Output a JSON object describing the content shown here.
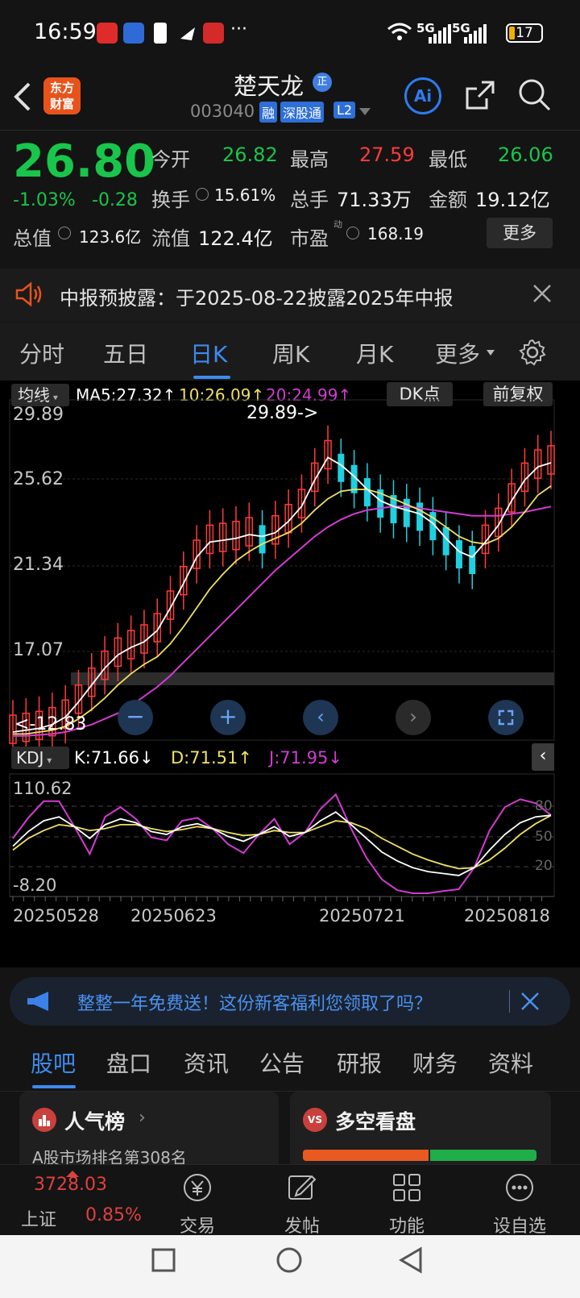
{
  "status_bar": {
    "time": "16:59",
    "network1": "5G",
    "network2": "5G",
    "battery": "17",
    "more": "···"
  },
  "header": {
    "logo_line1": "东方",
    "logo_line2": "财富",
    "stock_name": "楚天龙",
    "badge_zheng": "正",
    "stock_code": "003040",
    "tag_rong": "融",
    "tag_sgt": "深股通",
    "tag_l2": "L2",
    "ai_label": "Ai"
  },
  "quote": {
    "price": "26.80",
    "change_pct": "-1.03%",
    "change_abs": "-0.28",
    "open_label": "今开",
    "open": "26.82",
    "high_label": "最高",
    "high": "27.59",
    "low_label": "最低",
    "low": "26.06",
    "turnover_label": "换手",
    "turnover": "15.61%",
    "volume_label": "总手",
    "volume": "71.33万",
    "amount_label": "金额",
    "amount": "19.12亿",
    "mktcap_label": "总值",
    "mktcap": "123.6亿",
    "float_label": "流值",
    "float": "122.4亿",
    "pe_label": "市盈",
    "pe_sup": "动",
    "pe": "168.19",
    "more_button": "更多"
  },
  "notice": {
    "text": "中报预披露：于2025-08-22披露2025年中报"
  },
  "chart_tabs": {
    "items": [
      "分时",
      "五日",
      "日K",
      "周K",
      "月K",
      "更多"
    ],
    "active": "日K"
  },
  "kline": {
    "ma_selector": "均线",
    "ma5_label": "MA5:27.32↑",
    "ma10_label": "10:26.09↑",
    "ma20_label": "20:24.99↑",
    "dk_button": "DK点",
    "adjust_button": "前复权",
    "y_ticks": [
      "29.89",
      "25.62",
      "21.34",
      "17.07"
    ],
    "high_annotation": "29.89->",
    "low_annotation": "<-12.83",
    "colors": {
      "up": "#ff3b3b",
      "down": "#1fd0e0",
      "ma5": "#ffffff",
      "ma10": "#f0e060",
      "ma20": "#d33bd3"
    }
  },
  "kdj": {
    "selector": "KDJ",
    "k_label": "K:71.66↓",
    "d_label": "D:71.51↑",
    "j_label": "J:71.95↓",
    "y_top": "110.62",
    "y_bottom": "-8.20",
    "level_80": "80",
    "level_50": "50",
    "level_20": "20"
  },
  "x_axis": {
    "dates": [
      "20250528",
      "20250623",
      "20250721",
      "20250818"
    ]
  },
  "chart_data": {
    "type": "candlestick",
    "title": "",
    "y_range": [
      12.83,
      29.89
    ],
    "last_ma": {
      "ma5": 27.32,
      "ma10": 26.09,
      "ma20": 24.99
    },
    "x_ticks": [
      "20250528",
      "20250623",
      "20250721",
      "20250818"
    ],
    "series": [
      {
        "name": "MA5",
        "values": [
          13.0,
          13.1,
          13.2,
          13.4,
          13.8,
          14.6,
          15.5,
          16.4,
          17.1,
          17.5,
          17.8,
          18.4,
          19.6,
          20.9,
          22.3,
          23.1,
          23.2,
          23.3,
          23.5,
          23.4,
          23.6,
          24.2,
          25.0,
          26.4,
          27.6,
          27.2,
          26.6,
          25.9,
          25.3,
          25.0,
          24.8,
          24.6,
          24.1,
          23.3,
          22.6,
          22.3,
          23.1,
          24.0,
          25.3,
          26.4,
          27.1,
          27.32
        ]
      },
      {
        "name": "10",
        "values": [
          12.9,
          12.9,
          13.0,
          13.1,
          13.3,
          13.7,
          14.2,
          14.8,
          15.5,
          16.1,
          16.6,
          17.0,
          17.7,
          18.6,
          19.6,
          20.6,
          21.4,
          22.1,
          22.6,
          23.0,
          23.3,
          23.6,
          24.1,
          24.8,
          25.4,
          25.8,
          25.9,
          25.9,
          25.7,
          25.4,
          25.1,
          24.8,
          24.4,
          23.9,
          23.4,
          23.1,
          23.0,
          23.3,
          23.9,
          24.7,
          25.6,
          26.09
        ]
      },
      {
        "name": "20",
        "values": [
          12.8,
          12.8,
          12.85,
          12.9,
          13.0,
          13.2,
          13.4,
          13.7,
          14.0,
          14.4,
          14.9,
          15.4,
          16.0,
          16.7,
          17.4,
          18.1,
          18.8,
          19.5,
          20.2,
          20.9,
          21.6,
          22.2,
          22.8,
          23.4,
          23.9,
          24.3,
          24.6,
          24.8,
          24.9,
          25.0,
          25.0,
          24.9,
          24.8,
          24.7,
          24.6,
          24.5,
          24.5,
          24.5,
          24.6,
          24.7,
          24.85,
          24.99
        ]
      }
    ]
  },
  "banner": {
    "text": "整整一年免费送！这份新客福利您领取了吗？"
  },
  "bottom_tabs": {
    "items": [
      "股吧",
      "盘口",
      "资讯",
      "公告",
      "研报",
      "财务",
      "资料"
    ],
    "active": "股吧"
  },
  "cards": {
    "popularity_title": "人气榜",
    "popularity_sub": "A股市场排名第308名",
    "bullbear_title": "多空看盘"
  },
  "bottom_nav": {
    "index_value": "3728.03",
    "index_name": "上证",
    "index_change": "0.85%",
    "items": [
      "交易",
      "发帖",
      "功能",
      "自选"
    ],
    "item_setting": "设"
  }
}
